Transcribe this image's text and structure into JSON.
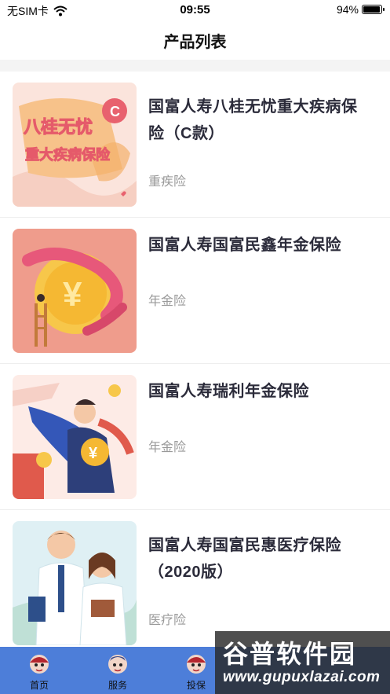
{
  "status_bar": {
    "carrier": "无SIM卡",
    "time": "09:55",
    "battery": "94%",
    "battery_level": 0.94
  },
  "nav": {
    "title": "产品列表"
  },
  "products": [
    {
      "title_line1": "国富人寿八桂无忧重大疾病保",
      "title_line2": "险（C款）",
      "tag": "重疾险",
      "thumb_text1": "八桂无忧",
      "thumb_text2": "重大疾病保险",
      "thumb_badge": "C"
    },
    {
      "title_line1": "国富人寿国富民鑫年金保险",
      "title_line2": "",
      "tag": "年金险",
      "thumb_symbol": "¥"
    },
    {
      "title_line1": "国富人寿瑞利年金保险",
      "title_line2": "",
      "tag": "年金险",
      "thumb_symbol": "¥"
    },
    {
      "title_line1": "国富人寿国富民惠医疗保险",
      "title_line2": "（2020版）",
      "tag": "医疗险"
    }
  ],
  "tabs": [
    {
      "label": "首页",
      "icon": "mascot-icon"
    },
    {
      "label": "服务",
      "icon": "mascot-icon"
    },
    {
      "label": "投保",
      "icon": "mascot-icon"
    }
  ],
  "watermark": {
    "logo": "谷普软件园",
    "url": "www.gupuxlazai.com"
  },
  "colors": {
    "tab_bar": "#4d7ed9",
    "tag_gray": "#999999",
    "title": "#2b2b3a"
  }
}
